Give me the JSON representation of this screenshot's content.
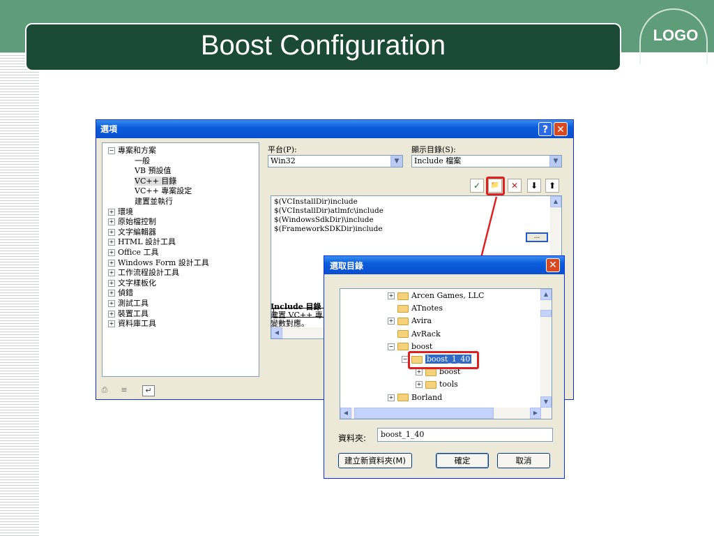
{
  "slide": {
    "title": "Boost Configuration",
    "logo": "LOGO",
    "colors": {
      "band": "#5f9c79",
      "title_bg": "#1b4a36",
      "annotation": "#e02020"
    }
  },
  "options_dialog": {
    "title": "選項",
    "help_label": "?",
    "close_label": "✕",
    "tree": [
      {
        "label": "專案和方案",
        "expander": "−",
        "level": 0
      },
      {
        "label": "一般",
        "expander": "",
        "level": 1
      },
      {
        "label": "VB 預設值",
        "expander": "",
        "level": 1
      },
      {
        "label": "VC++ 目錄",
        "expander": "",
        "level": 1,
        "selected": true
      },
      {
        "label": "VC++ 專案設定",
        "expander": "",
        "level": 1
      },
      {
        "label": "建置並執行",
        "expander": "",
        "level": 1
      },
      {
        "label": "環境",
        "expander": "+",
        "level": 0
      },
      {
        "label": "原始檔控制",
        "expander": "+",
        "level": 0
      },
      {
        "label": "文字編輯器",
        "expander": "+",
        "level": 0
      },
      {
        "label": "HTML 設計工具",
        "expander": "+",
        "level": 0
      },
      {
        "label": "Office 工具",
        "expander": "+",
        "level": 0
      },
      {
        "label": "Windows Form 設計工具",
        "expander": "+",
        "level": 0
      },
      {
        "label": "工作流程設計工具",
        "expander": "+",
        "level": 0
      },
      {
        "label": "文字樣板化",
        "expander": "+",
        "level": 0
      },
      {
        "label": "偵錯",
        "expander": "+",
        "level": 0
      },
      {
        "label": "測試工具",
        "expander": "+",
        "level": 0
      },
      {
        "label": "裝置工具",
        "expander": "+",
        "level": 0
      },
      {
        "label": "資料庫工具",
        "expander": "+",
        "level": 0
      }
    ],
    "platform_label": "平台(P):",
    "platform_value": "Win32",
    "show_dirs_label": "顯示目錄(S):",
    "show_dirs_value": "Include 檔案",
    "toolbar": {
      "check": "✓",
      "new_folder": "📁",
      "delete": "✕",
      "down": "⬇",
      "up": "⬆"
    },
    "directories": [
      "$(VCInstallDir)include",
      "$(VCInstallDir)atlmfc\\include",
      "$(WindowsSdkDir)\\include",
      "$(FrameworkSDKDir)include"
    ],
    "edit_value": "",
    "browse_label": "...",
    "description_title": "Include 目錄",
    "description_line1": "建置 VC++ 專",
    "description_line2": "變數對應。"
  },
  "folder_dialog": {
    "title": "選取目錄",
    "close_label": "✕",
    "tree": [
      {
        "label": "Arcen Games, LLC",
        "expander": "+",
        "level": 0
      },
      {
        "label": "ATnotes",
        "expander": "",
        "level": 0
      },
      {
        "label": "Avira",
        "expander": "+",
        "level": 0
      },
      {
        "label": "AvRack",
        "expander": "",
        "level": 0
      },
      {
        "label": "boost",
        "expander": "−",
        "level": 0
      },
      {
        "label": "boost_1_40",
        "expander": "−",
        "level": 1,
        "selected": true
      },
      {
        "label": "boost",
        "expander": "+",
        "level": 2
      },
      {
        "label": "tools",
        "expander": "+",
        "level": 2
      },
      {
        "label": "Borland",
        "expander": "+",
        "level": 0
      }
    ],
    "folder_label": "資料夾:",
    "folder_value": "boost_1_40",
    "new_folder_button": "建立新資料夾(M)",
    "ok_button": "確定",
    "cancel_button": "取消"
  }
}
